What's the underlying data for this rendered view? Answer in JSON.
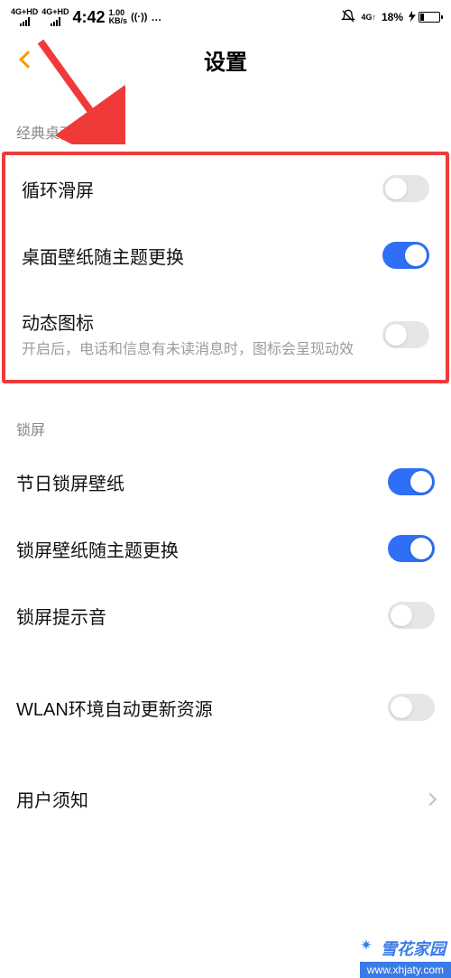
{
  "status": {
    "net1_label": "4G+HD",
    "net2_label": "4G+HD",
    "time": "4:42",
    "speed_num": "1.00",
    "speed_unit": "KB/s",
    "wifi_glyph": "((·))",
    "dots": "…",
    "bell_glyph": "🔕",
    "net_right_label": "4G↑",
    "battery_pct": "18%",
    "charging_glyph": "⚡"
  },
  "header": {
    "title": "设置"
  },
  "section_desktop": {
    "label": "经典桌面",
    "loop": {
      "title": "循环滑屏",
      "on": false
    },
    "wallpaper_theme": {
      "title": "桌面壁纸随主题更换",
      "on": true
    },
    "dynamic_icons": {
      "title": "动态图标",
      "sub": "开启后，电话和信息有未读消息时，图标会呈现动效",
      "on": false
    }
  },
  "section_lock": {
    "label": "锁屏",
    "holiday_wallpaper": {
      "title": "节日锁屏壁纸",
      "on": true
    },
    "lock_wallpaper_theme": {
      "title": "锁屏壁纸随主题更换",
      "on": true
    },
    "lock_sound": {
      "title": "锁屏提示音",
      "on": false
    }
  },
  "wlan_update": {
    "title": "WLAN环境自动更新资源",
    "on": false
  },
  "user_notice": {
    "title": "用户须知"
  },
  "watermark": {
    "name": "雪花家园",
    "url": "www.xhjaty.com"
  },
  "colors": {
    "accent_orange": "#ff9500",
    "toggle_on": "#2e6ff6",
    "highlight_red": "#f03a3a"
  }
}
